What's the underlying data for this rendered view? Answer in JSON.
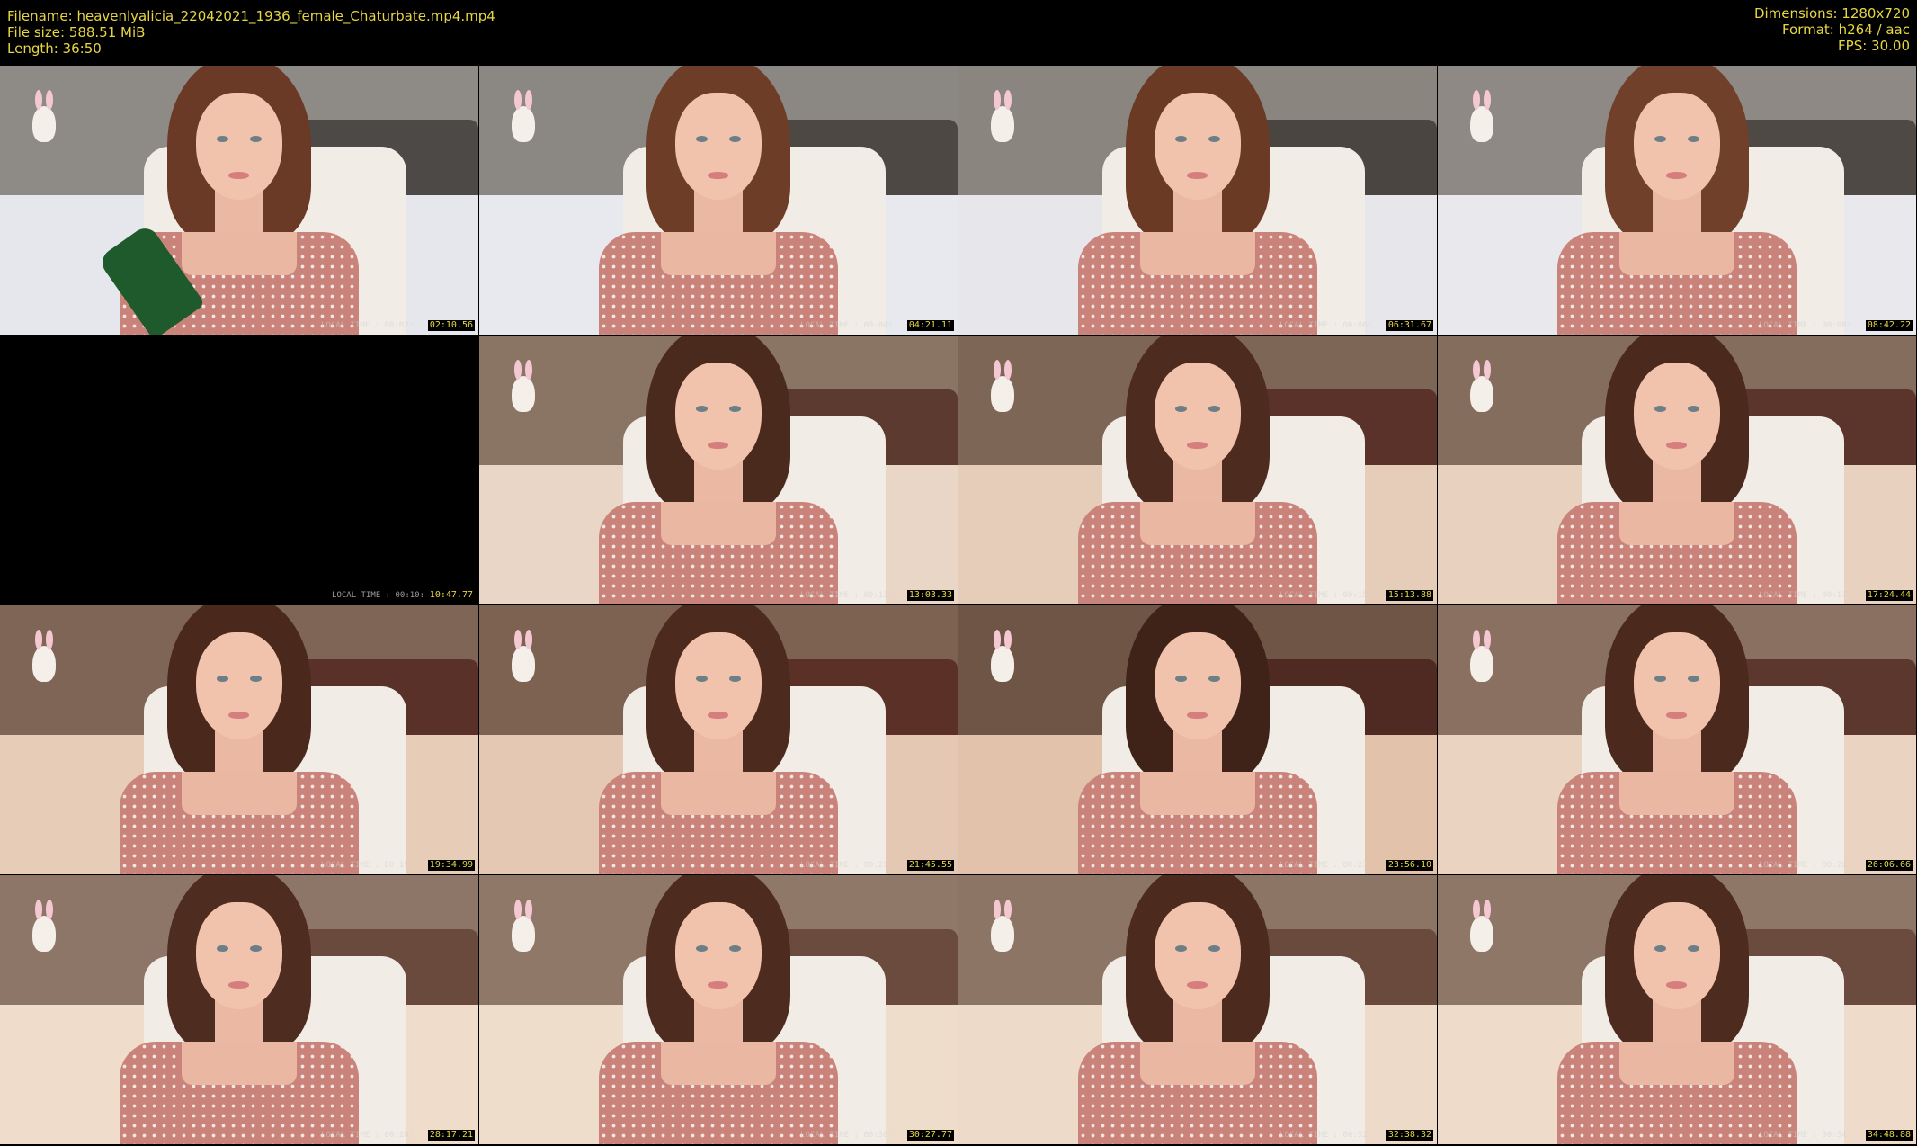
{
  "header": {
    "filename_line": "Filename: heavenlyalicia_22042021_1936_female_Chaturbate.mp4.mp4",
    "filesize_line": "File size: 588.51 MiB",
    "length_line": "Length: 36:50",
    "dimensions_line": "Dimensions: 1280x720",
    "format_line": "Format: h264 / aac",
    "fps_line": "FPS: 30.00"
  },
  "colors": {
    "header_text": "#e6d642",
    "background": "#000000"
  },
  "thumbnails": [
    {
      "time": "02:10.56",
      "overlay": "LOCAL TIME : 00:02:"
    },
    {
      "time": "04:21.11",
      "overlay": "LOCAL TIME : 00:04:"
    },
    {
      "time": "06:31.67",
      "overlay": "LOCAL TIME : 00:06:"
    },
    {
      "time": "08:42.22",
      "overlay": "LOCAL TIME : 00:08:"
    },
    {
      "time": "10:47.77",
      "overlay": "LOCAL TIME : 00:10:"
    },
    {
      "time": "13:03.33",
      "overlay": "LOCAL TIME : 00:13:"
    },
    {
      "time": "15:13.88",
      "overlay": "LOCAL TIME : 00:15:"
    },
    {
      "time": "17:24.44",
      "overlay": "LOCAL TIME : 00:17:"
    },
    {
      "time": "19:34.99",
      "overlay": "LOCAL TIME : 00:19:"
    },
    {
      "time": "21:45.55",
      "overlay": "LOCAL TIME : 00:21:"
    },
    {
      "time": "23:56.10",
      "overlay": "LOCAL TIME : 00:23:"
    },
    {
      "time": "26:06.66",
      "overlay": "LOCAL TIME : 00:26:"
    },
    {
      "time": "28:17.21",
      "overlay": "LOCAL TIME : 00:28:"
    },
    {
      "time": "30:27.77",
      "overlay": "LOCAL TIME : 00:30:"
    },
    {
      "time": "32:38.32",
      "overlay": "LOCAL TIME : 00:32:"
    },
    {
      "time": "34:48.88",
      "overlay": "LOCAL TIME : 00:34:"
    }
  ]
}
